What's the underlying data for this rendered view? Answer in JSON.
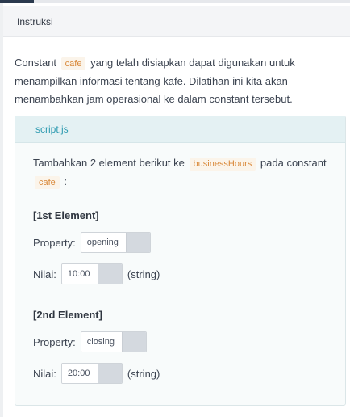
{
  "header": {
    "title": "Instruksi"
  },
  "intro": {
    "before": "Constant",
    "code": "cafe",
    "after": "yang telah disiapkan dapat digunakan untuk menampilkan informasi tentang kafe. Dilatihan ini kita akan menambahkan jam operasional ke dalam constant tersebut."
  },
  "card": {
    "filename": "script.js",
    "task": {
      "before": "Tambahkan 2 element berikut ke",
      "code1": "businessHours",
      "middle": "pada constant",
      "code2": "cafe",
      "after": ":"
    },
    "elements": [
      {
        "title": "[1st Element]",
        "property_label": "Property:",
        "property_value": "opening",
        "value_label": "Nilai:",
        "value_value": "10:00",
        "value_suffix": "(string)"
      },
      {
        "title": "[2nd Element]",
        "property_label": "Property:",
        "property_value": "closing",
        "value_label": "Nilai:",
        "value_value": "20:00",
        "value_suffix": "(string)"
      }
    ]
  }
}
